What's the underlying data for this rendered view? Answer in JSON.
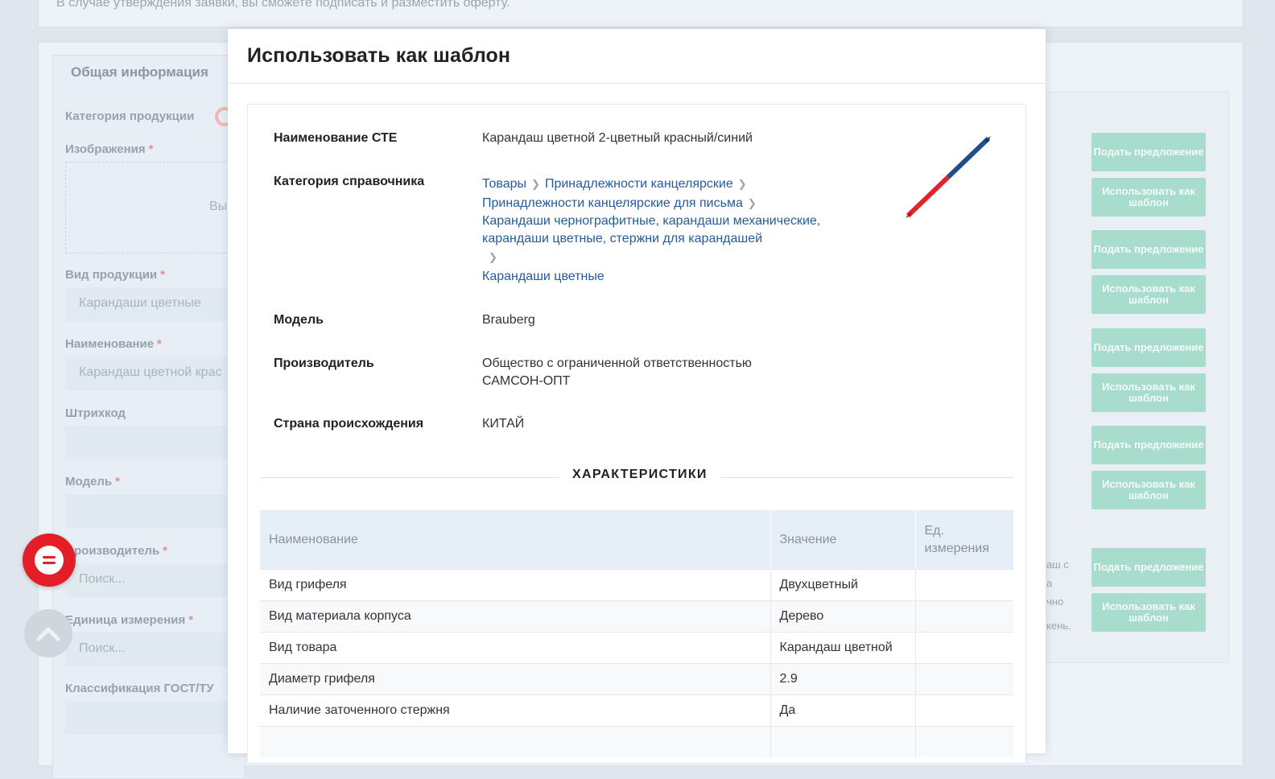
{
  "background": {
    "notice": "В случае утверждения заявки, вы сможете подписать и разместить оферту.",
    "section_title": "Общая информация",
    "fields": [
      {
        "label": "Категория продукции",
        "required": false,
        "value": ""
      },
      {
        "label": "Изображения",
        "required": true,
        "value": ""
      },
      {
        "label": "Вид продукции",
        "required": true,
        "value": "Карандаши цветные"
      },
      {
        "label": "Наименование",
        "required": true,
        "value": "Карандаш цветной крас"
      },
      {
        "label": "Штрихкод",
        "required": false,
        "value": ""
      },
      {
        "label": "Модель",
        "required": true,
        "value": ""
      },
      {
        "label": "роизводитель",
        "required": true,
        "value": "Поиск..."
      },
      {
        "label": "Единица измерения",
        "required": true,
        "value": "Поиск..."
      },
      {
        "label": "Классификация ГОСТ/ТУ",
        "required": false,
        "value": ""
      }
    ],
    "dropzone_text": "Вы",
    "required_mark": "*",
    "buttons": {
      "offer": "Подать предложение",
      "template": "Использовать как шаблон"
    },
    "fragments": [
      "аш с",
      "а",
      "чно",
      "кень."
    ]
  },
  "modal": {
    "title": "Использовать как шаблон",
    "details": {
      "name_label": "Наименование СТЕ",
      "name_value": "Карандаш цветной 2-цветный красный/синий",
      "category_label": "Категория справочника",
      "category_path": [
        "Товары",
        "Принадлежности канцелярские",
        "Принадлежности канцелярские для письма",
        "Карандаши чернографитные, карандаши механические,",
        "карандаши цветные, стержни для карандашей",
        "Карандаши цветные"
      ],
      "model_label": "Модель",
      "model_value": "Brauberg",
      "manufacturer_label": "Производитель",
      "manufacturer_line1": "Общество с ограниченной ответственностью",
      "manufacturer_line2": "САМСОН-ОПТ",
      "country_label": "Страна происхождения",
      "country_value": "КИТАЙ"
    },
    "characteristics": {
      "title": "ХАРАКТЕРИСТИКИ",
      "headers": [
        "Наименование",
        "Значение",
        "Ед. измерения"
      ],
      "rows": [
        {
          "name": "Вид грифеля",
          "value": "Двухцветный",
          "unit": ""
        },
        {
          "name": "Вид материала корпуса",
          "value": "Дерево",
          "unit": ""
        },
        {
          "name": "Вид товара",
          "value": "Карандаш цветной",
          "unit": ""
        },
        {
          "name": "Диаметр грифеля",
          "value": "2.9",
          "unit": ""
        },
        {
          "name": "Наличие заточенного стержня",
          "value": "Да",
          "unit": ""
        },
        {
          "name": "",
          "value": "",
          "unit": ""
        }
      ]
    }
  },
  "colors": {
    "accent_link": "#265b9c",
    "chat_button": "#e41e26",
    "offer_button": "#a8dccc"
  }
}
